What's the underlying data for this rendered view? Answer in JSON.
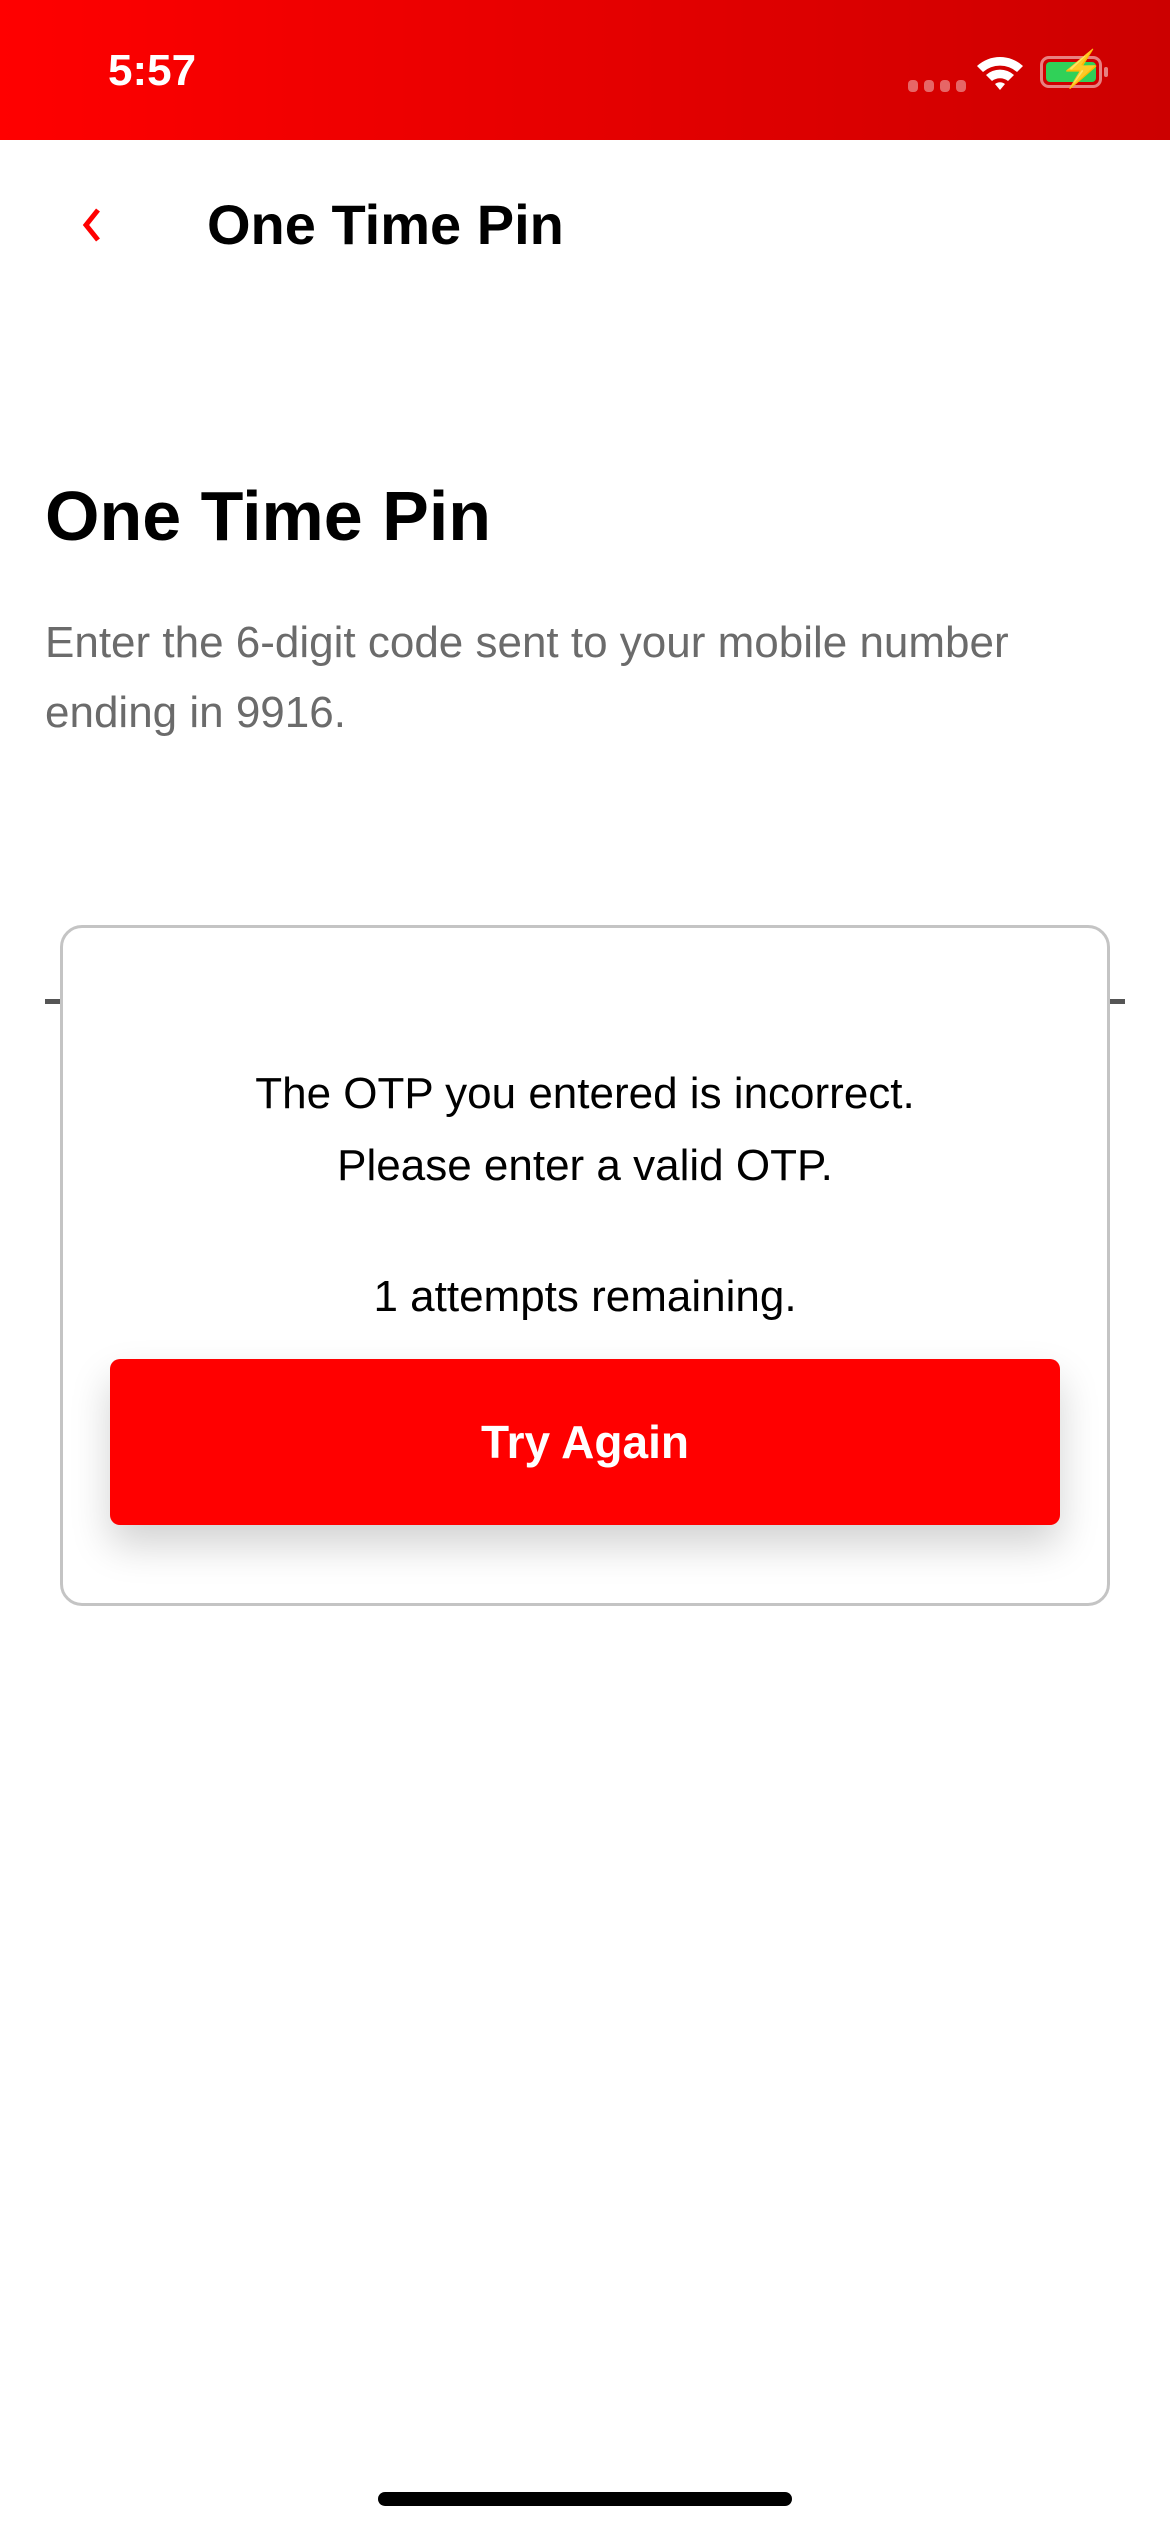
{
  "status_bar": {
    "time": "5:57",
    "icons": [
      "signal-icon",
      "wifi-icon",
      "battery-charging-icon"
    ]
  },
  "nav": {
    "title": "One Time Pin",
    "back_icon": "chevron-left-icon"
  },
  "main": {
    "heading": "One Time Pin",
    "subtitle": "Enter the 6-digit code sent to your mobile number ending in 9916."
  },
  "dialog": {
    "line1": "The OTP you entered is incorrect.",
    "line2": "Please enter a valid OTP.",
    "attempts": "1 attempts remaining.",
    "button_label": "Try Again",
    "button_color": "#ff0000"
  },
  "colors": {
    "brand": "#ff0000",
    "battery": "#30d158"
  }
}
